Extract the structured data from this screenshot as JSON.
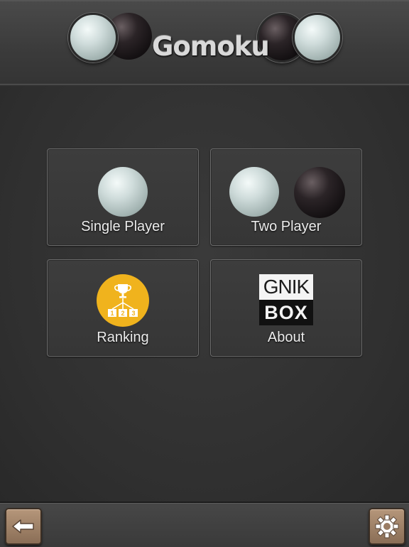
{
  "header": {
    "title": "Gomoku",
    "decorations": [
      "white-stone",
      "black-stone",
      "black-stone",
      "white-stone"
    ]
  },
  "menu": {
    "items": [
      {
        "label": "Single Player",
        "icon": "white-stone-icon"
      },
      {
        "label": "Two Player",
        "icon": "white-and-black-stones-icon"
      },
      {
        "label": "Ranking",
        "icon": "trophy-ranking-icon"
      },
      {
        "label": "About",
        "icon": "gnikbox-logo"
      }
    ]
  },
  "about_logo": {
    "line1": "GNIK",
    "line2": "BOX"
  },
  "ranking_icon": {
    "ranks": [
      "1",
      "2",
      "3"
    ]
  },
  "footer": {
    "back_icon": "back-arrow-icon",
    "settings_icon": "gear-icon"
  },
  "colors": {
    "background": "#333333",
    "tile_border": "#6c6c6c",
    "ranking_badge": "#f0b31d",
    "footer_button": "#a3846a"
  }
}
